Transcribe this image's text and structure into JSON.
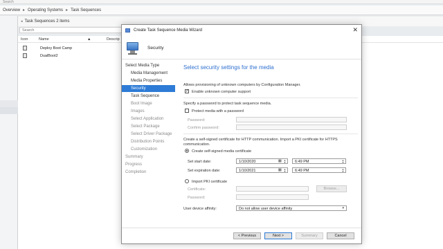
{
  "console": {
    "top_text": "Search",
    "breadcrumb": [
      "Overview",
      "Operating Systems",
      "Task Sequences"
    ],
    "list_header": "Task Sequences 2 items",
    "search_placeholder": "Search",
    "columns": [
      "Icon",
      "Name",
      "Descrip"
    ],
    "rows": [
      {
        "name": "Deploy Boot Camp"
      },
      {
        "name": "DualBoot2"
      }
    ]
  },
  "wizard": {
    "title": "Create Task Sequence Media Wizard",
    "page_title": "Security",
    "nav": [
      {
        "label": "Select Media Type",
        "level": 0,
        "state": "normal"
      },
      {
        "label": "Media Management",
        "level": 1,
        "state": "normal"
      },
      {
        "label": "Media Properties",
        "level": 1,
        "state": "normal"
      },
      {
        "label": "Security",
        "level": 1,
        "state": "selected"
      },
      {
        "label": "Task Sequence",
        "level": 1,
        "state": "normal"
      },
      {
        "label": "Boot Image",
        "level": 1,
        "state": "dim"
      },
      {
        "label": "Images",
        "level": 1,
        "state": "dim"
      },
      {
        "label": "Select Application",
        "level": 1,
        "state": "dim"
      },
      {
        "label": "Select Package",
        "level": 1,
        "state": "dim"
      },
      {
        "label": "Select Driver Package",
        "level": 1,
        "state": "dim"
      },
      {
        "label": "Distribution Points",
        "level": 1,
        "state": "dim"
      },
      {
        "label": "Customization",
        "level": 1,
        "state": "dim"
      },
      {
        "label": "Summary",
        "level": 0,
        "state": "dim"
      },
      {
        "label": "Progress",
        "level": 0,
        "state": "dim"
      },
      {
        "label": "Completion",
        "level": 0,
        "state": "dim"
      }
    ],
    "heading": "Select security settings for the media",
    "unknown_section": "Allows provisioning of unknown computers by Configuration Manager.",
    "enable_unknown_label": "Enable unknown computer support",
    "enable_unknown_checked": true,
    "password_section": "Specify a password to protect task sequence media.",
    "protect_label": "Protect media with a password",
    "protect_checked": false,
    "password_label": "Password:",
    "confirm_label": "Confirm password:",
    "cert_section": "Create a self-signed certificate for HTTP communication. Import a PKI certificate for HTTPS communication.",
    "self_signed_label": "Create self-signed media certificate",
    "self_signed_selected": true,
    "start_date_label": "Set start date:",
    "start_date": "1/10/2020",
    "start_time": "6:49 PM",
    "expiration_label": "Set expiration date:",
    "expiration_date": "1/10/2021",
    "expiration_time": "6:49 PM",
    "pki_label": "Import PKI certificate",
    "pki_selected": false,
    "certificate_label": "Certificate:",
    "browse_label": "Browse...",
    "pki_password_label": "Password:",
    "affinity_label": "User device affinity:",
    "affinity_value": "Do not allow user device affinity",
    "buttons": {
      "previous": "< Previous",
      "next": "Next >",
      "summary": "Summary",
      "cancel": "Cancel"
    }
  }
}
